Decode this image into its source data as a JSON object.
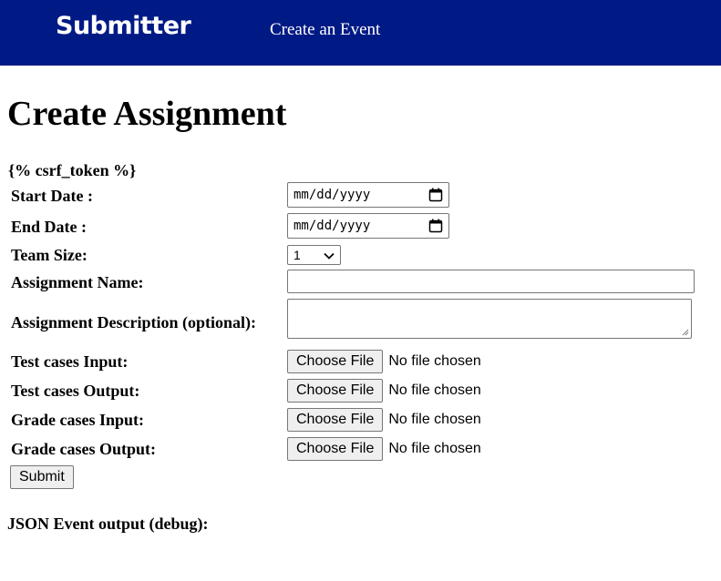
{
  "nav": {
    "brand": "Submitter",
    "link": "Create an Event",
    "bg_color": "#001a85"
  },
  "page": {
    "title": "Create Assignment",
    "csrf": "{% csrf_token %}"
  },
  "form": {
    "start_date": {
      "label": "Start Date :",
      "placeholder": "mm/dd/yyyy"
    },
    "end_date": {
      "label": "End Date :",
      "placeholder": "mm/dd/yyyy"
    },
    "team_size": {
      "label": "Team Size:",
      "value": "1"
    },
    "assignment_name": {
      "label": "Assignment Name:",
      "value": ""
    },
    "description": {
      "label": "Assignment Description (optional):",
      "value": ""
    },
    "files": [
      {
        "label": "Test cases Input:",
        "button": "Choose File",
        "status": "No file chosen"
      },
      {
        "label": "Test cases Output:",
        "button": "Choose File",
        "status": "No file chosen"
      },
      {
        "label": "Grade cases Input:",
        "button": "Choose File",
        "status": "No file chosen"
      },
      {
        "label": "Grade cases Output:",
        "button": "Choose File",
        "status": "No file chosen"
      }
    ],
    "submit": "Submit"
  },
  "debug": {
    "label": "JSON Event output (debug):"
  },
  "icons": {
    "calendar": "calendar-icon",
    "dropdown": "chevron-down-icon"
  }
}
